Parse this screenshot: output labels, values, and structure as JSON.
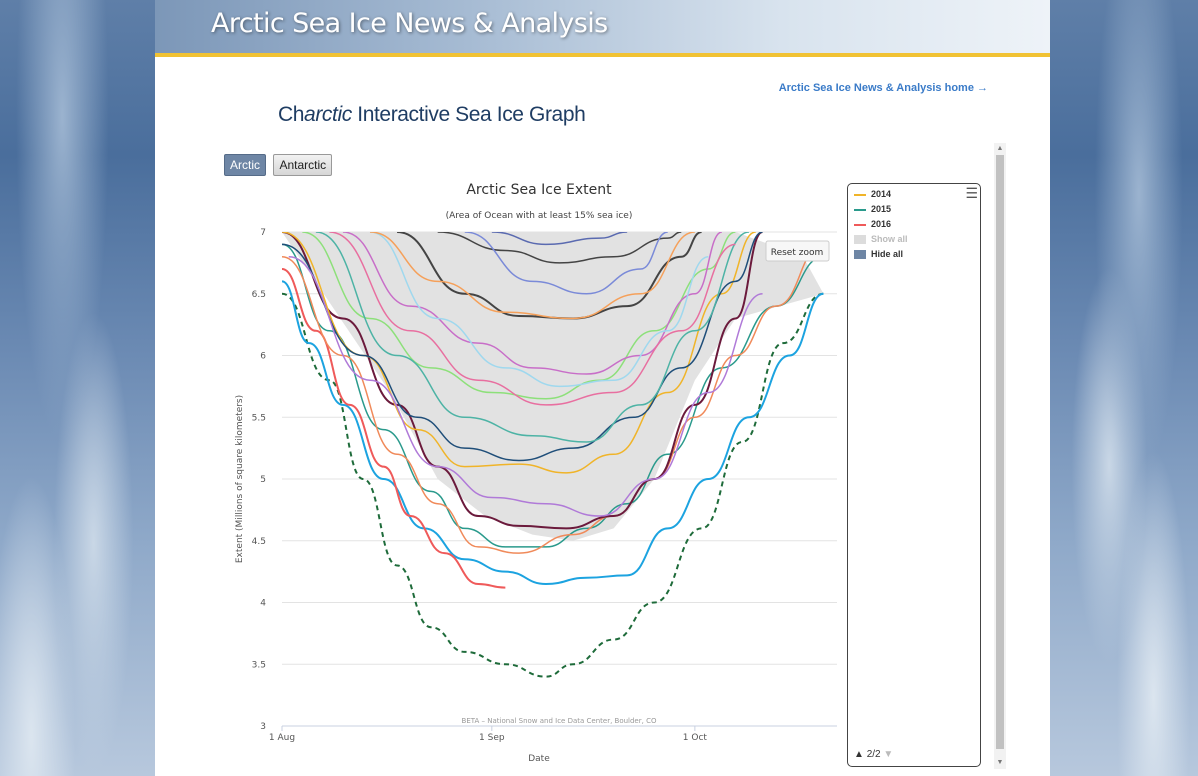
{
  "header": {
    "site_title": "Arctic Sea Ice News & Analysis",
    "home_link": "Arctic Sea Ice News & Analysis home →"
  },
  "page": {
    "title_prefix": "Ch",
    "title_italic": "arctic",
    "title_suffix": " Interactive Sea Ice Graph"
  },
  "tabs": [
    {
      "label": "Arctic",
      "active": true
    },
    {
      "label": "Antarctic",
      "active": false
    }
  ],
  "reset_zoom": "Reset zoom",
  "credit": "BETA – National Snow and Ice Data Center, Boulder, CO",
  "legend": {
    "items": [
      {
        "label": "2014",
        "color": "#f0b429"
      },
      {
        "label": "2015",
        "color": "#2a9a8c"
      },
      {
        "label": "2016",
        "color": "#ef5a5a"
      }
    ],
    "show_all": "Show all",
    "hide_all": "Hide all",
    "pager": "2/2"
  },
  "chart_data": {
    "type": "line",
    "title": "Arctic Sea Ice Extent",
    "subtitle": "(Area of Ocean with at least 15% sea ice)",
    "xlabel": "Date",
    "ylabel": "Extent (Millions of square kilometers)",
    "x_ticks": [
      "1 Aug",
      "1 Sep",
      "1 Oct"
    ],
    "x_tick_days": [
      213,
      244,
      274
    ],
    "xlim": [
      213,
      295
    ],
    "ylim": [
      3,
      7
    ],
    "y_ticks": [
      "3",
      "3.5",
      "4",
      "4.5",
      "5",
      "5.5",
      "6",
      "6.5",
      "7"
    ],
    "band": {
      "upper": [
        [
          213,
          7.0
        ],
        [
          225,
          7.0
        ],
        [
          240,
          7.0
        ],
        [
          260,
          7.0
        ],
        [
          280,
          7.0
        ],
        [
          290,
          6.8
        ],
        [
          293,
          6.5
        ]
      ],
      "lower": [
        [
          229,
          5.7
        ],
        [
          236,
          5.0
        ],
        [
          243,
          4.7
        ],
        [
          250,
          4.55
        ],
        [
          256,
          4.5
        ],
        [
          262,
          4.6
        ],
        [
          268,
          5.0
        ],
        [
          274,
          5.8
        ],
        [
          280,
          6.3
        ],
        [
          293,
          6.5
        ]
      ]
    },
    "series": [
      {
        "values": [
          [
            213,
            6.5
          ],
          [
            220,
            5.8
          ],
          [
            225,
            5.0
          ],
          [
            230,
            4.3
          ],
          [
            235,
            3.8
          ],
          [
            240,
            3.6
          ],
          [
            246,
            3.5
          ],
          [
            252,
            3.4
          ],
          [
            256,
            3.5
          ],
          [
            262,
            3.7
          ],
          [
            268,
            4.0
          ],
          [
            275,
            4.6
          ],
          [
            281,
            5.3
          ],
          [
            287,
            6.1
          ],
          [
            293,
            6.5
          ]
        ],
        "color": "#1e6b3a",
        "dash": true,
        "width": 2
      },
      {
        "values": [
          [
            213,
            6.6
          ],
          [
            217,
            6.1
          ],
          [
            222,
            5.6
          ],
          [
            228,
            5.0
          ],
          [
            234,
            4.6
          ],
          [
            240,
            4.35
          ],
          [
            246,
            4.25
          ],
          [
            252,
            4.15
          ],
          [
            258,
            4.2
          ],
          [
            264,
            4.22
          ],
          [
            270,
            4.6
          ],
          [
            276,
            5.0
          ],
          [
            282,
            5.5
          ],
          [
            288,
            6.0
          ],
          [
            293,
            6.5
          ]
        ],
        "color": "#1ca3e0",
        "width": 2
      },
      {
        "values": [
          [
            213,
            6.7
          ],
          [
            218,
            6.2
          ],
          [
            223,
            5.6
          ],
          [
            228,
            5.1
          ],
          [
            232,
            4.7
          ],
          [
            237,
            4.4
          ],
          [
            242,
            4.15
          ],
          [
            246,
            4.12
          ]
        ],
        "color": "#ef5a5a",
        "width": 2
      },
      {
        "values": [
          [
            213,
            6.9
          ],
          [
            220,
            6.2
          ],
          [
            228,
            5.4
          ],
          [
            235,
            4.9
          ],
          [
            240,
            4.6
          ],
          [
            246,
            4.45
          ],
          [
            252,
            4.45
          ],
          [
            258,
            4.6
          ],
          [
            264,
            4.8
          ],
          [
            270,
            5.2
          ],
          [
            278,
            5.9
          ],
          [
            286,
            6.4
          ],
          [
            293,
            6.8
          ]
        ],
        "color": "#2a9a8c",
        "width": 1.5
      },
      {
        "values": [
          [
            213,
            6.8
          ],
          [
            222,
            6.0
          ],
          [
            230,
            5.2
          ],
          [
            236,
            4.8
          ],
          [
            242,
            4.45
          ],
          [
            248,
            4.4
          ],
          [
            256,
            4.55
          ],
          [
            262,
            4.7
          ],
          [
            268,
            5.0
          ],
          [
            274,
            5.5
          ],
          [
            280,
            6.0
          ],
          [
            286,
            6.4
          ],
          [
            293,
            6.9
          ]
        ],
        "color": "#f08a5a",
        "width": 1.5
      },
      {
        "values": [
          [
            213,
            7.0
          ],
          [
            222,
            6.3
          ],
          [
            230,
            5.6
          ],
          [
            236,
            5.1
          ],
          [
            242,
            4.7
          ],
          [
            248,
            4.62
          ],
          [
            255,
            4.6
          ],
          [
            262,
            4.7
          ],
          [
            268,
            5.0
          ],
          [
            274,
            5.6
          ],
          [
            280,
            6.3
          ],
          [
            284,
            7.0
          ]
        ],
        "color": "#6b1a3c",
        "width": 2
      },
      {
        "values": [
          [
            213,
            7.0
          ],
          [
            225,
            6.0
          ],
          [
            233,
            5.4
          ],
          [
            240,
            5.1
          ],
          [
            248,
            5.12
          ],
          [
            255,
            5.05
          ],
          [
            262,
            5.2
          ],
          [
            270,
            5.7
          ],
          [
            278,
            6.5
          ],
          [
            283,
            7.0
          ]
        ],
        "color": "#f0b429",
        "width": 1.5
      },
      {
        "values": [
          [
            213,
            6.9
          ],
          [
            225,
            6.0
          ],
          [
            233,
            5.5
          ],
          [
            240,
            5.25
          ],
          [
            248,
            5.15
          ],
          [
            256,
            5.25
          ],
          [
            265,
            5.5
          ],
          [
            272,
            5.9
          ],
          [
            280,
            6.6
          ],
          [
            284,
            7.0
          ]
        ],
        "color": "#1f4e79",
        "width": 1.5
      },
      {
        "values": [
          [
            216,
            7.0
          ],
          [
            226,
            6.3
          ],
          [
            235,
            5.9
          ],
          [
            244,
            5.7
          ],
          [
            252,
            5.65
          ],
          [
            260,
            5.8
          ],
          [
            268,
            6.2
          ],
          [
            276,
            6.7
          ],
          [
            280,
            7.0
          ]
        ],
        "color": "#8de07a",
        "width": 1.5
      },
      {
        "values": [
          [
            222,
            7.0
          ],
          [
            232,
            6.4
          ],
          [
            242,
            6.1
          ],
          [
            250,
            5.9
          ],
          [
            258,
            5.85
          ],
          [
            266,
            6.0
          ],
          [
            274,
            6.5
          ],
          [
            278,
            7.0
          ]
        ],
        "color": "#c86ec8",
        "width": 1.5
      },
      {
        "values": [
          [
            230,
            7.0
          ],
          [
            240,
            6.5
          ],
          [
            248,
            6.32
          ],
          [
            256,
            6.3
          ],
          [
            264,
            6.4
          ],
          [
            272,
            6.8
          ],
          [
            275,
            7.0
          ]
        ],
        "color": "#444444",
        "width": 2
      },
      {
        "values": [
          [
            236,
            7.0
          ],
          [
            246,
            6.85
          ],
          [
            254,
            6.75
          ],
          [
            262,
            6.8
          ],
          [
            270,
            6.95
          ],
          [
            272,
            7.0
          ]
        ],
        "color": "#444444",
        "width": 1.5
      },
      {
        "values": [
          [
            226,
            7.0
          ],
          [
            236,
            6.3
          ],
          [
            246,
            5.9
          ],
          [
            254,
            5.75
          ],
          [
            262,
            5.8
          ],
          [
            270,
            6.2
          ],
          [
            276,
            6.8
          ]
        ],
        "color": "#9fd8ee",
        "width": 1.5
      },
      {
        "values": [
          [
            218,
            7.0
          ],
          [
            230,
            6.0
          ],
          [
            240,
            5.5
          ],
          [
            250,
            5.35
          ],
          [
            258,
            5.3
          ],
          [
            266,
            5.6
          ],
          [
            274,
            6.2
          ],
          [
            282,
            7.0
          ]
        ],
        "color": "#4db3a5",
        "width": 1.5
      },
      {
        "values": [
          [
            220,
            7.0
          ],
          [
            232,
            6.2
          ],
          [
            242,
            5.8
          ],
          [
            252,
            5.6
          ],
          [
            262,
            5.7
          ],
          [
            272,
            6.2
          ],
          [
            280,
            6.9
          ]
        ],
        "color": "#e86fa0",
        "width": 1.5
      },
      {
        "values": [
          [
            226,
            7.0
          ],
          [
            236,
            6.6
          ],
          [
            246,
            6.35
          ],
          [
            256,
            6.3
          ],
          [
            266,
            6.5
          ],
          [
            274,
            7.0
          ]
        ],
        "color": "#f5a05a",
        "width": 1.5
      },
      {
        "values": [
          [
            214,
            6.8
          ],
          [
            226,
            5.8
          ],
          [
            236,
            5.1
          ],
          [
            244,
            4.85
          ],
          [
            252,
            4.8
          ],
          [
            260,
            4.7
          ],
          [
            268,
            5.0
          ],
          [
            276,
            5.7
          ],
          [
            284,
            6.5
          ]
        ],
        "color": "#b07ad8",
        "width": 1.5
      },
      {
        "values": [
          [
            240,
            7.0
          ],
          [
            250,
            6.6
          ],
          [
            258,
            6.5
          ],
          [
            266,
            6.7
          ],
          [
            270,
            7.0
          ]
        ],
        "color": "#7a8ad8",
        "width": 1.5
      },
      {
        "values": [
          [
            244,
            7.0
          ],
          [
            252,
            6.9
          ],
          [
            260,
            6.95
          ],
          [
            264,
            7.0
          ]
        ],
        "color": "#5a6ab0",
        "width": 1.5
      }
    ]
  }
}
